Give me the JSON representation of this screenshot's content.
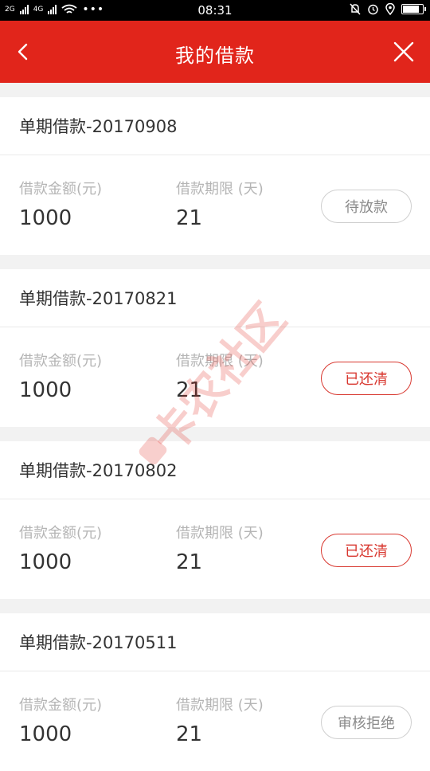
{
  "status_bar": {
    "left_text_1": "2G",
    "left_text_2": "4G",
    "time": "08:31",
    "battery_level": 0.9
  },
  "header": {
    "title": "我的借款",
    "back_icon": "chevron-left-icon",
    "close_icon": "close-icon",
    "background_color": "#e1251b"
  },
  "loans": [
    {
      "title": "单期借款-20170908",
      "amount_label": "借款金额(元)",
      "amount": "1000",
      "term_label": "借款期限 (天)",
      "term": "21",
      "status": "待放款",
      "status_color": "#8a8a8a"
    },
    {
      "title": "单期借款-20170821",
      "amount_label": "借款金额(元)",
      "amount": "1000",
      "term_label": "借款期限 (天)",
      "term": "21",
      "status": "已还清",
      "status_color": "#d8372f"
    },
    {
      "title": "单期借款-20170802",
      "amount_label": "借款金额(元)",
      "amount": "1000",
      "term_label": "借款期限 (天)",
      "term": "21",
      "status": "已还清",
      "status_color": "#d8372f"
    },
    {
      "title": "单期借款-20170511",
      "amount_label": "借款金额(元)",
      "amount": "1000",
      "term_label": "借款期限 (天)",
      "term": "21",
      "status": "审核拒绝",
      "status_color": "#8a8a8a"
    }
  ],
  "watermark": {
    "text": "卡农社区"
  }
}
